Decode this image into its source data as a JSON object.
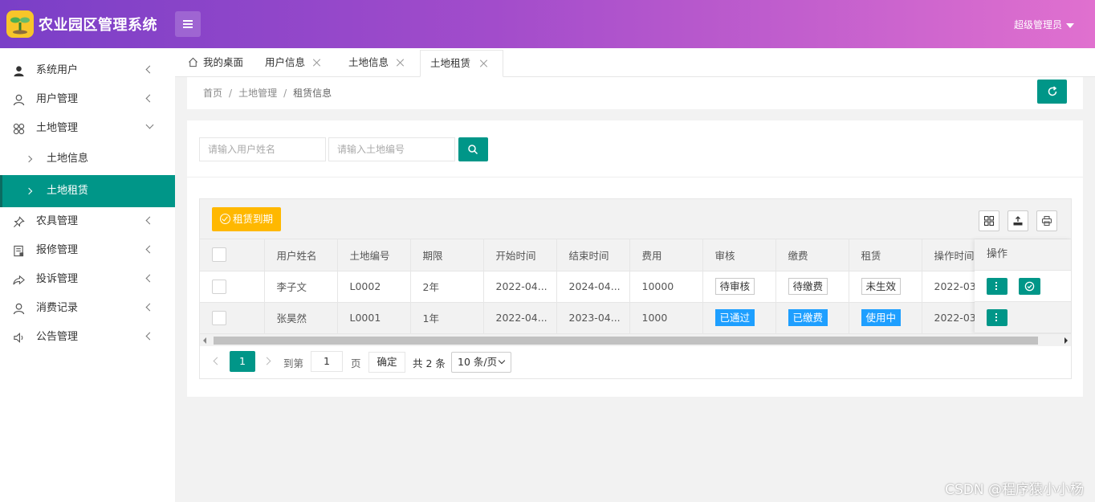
{
  "header": {
    "app_title": "农业园区管理系统",
    "user_label": "超级管理员"
  },
  "sidebar": {
    "items": [
      {
        "label": "系统用户",
        "icon": "person-filled-icon"
      },
      {
        "label": "用户管理",
        "icon": "person-outline-icon"
      },
      {
        "label": "土地管理",
        "icon": "grid-flower-icon",
        "expanded": true,
        "children": [
          {
            "label": "土地信息"
          },
          {
            "label": "土地租赁",
            "active": true
          }
        ]
      },
      {
        "label": "农具管理",
        "icon": "pin-icon"
      },
      {
        "label": "报修管理",
        "icon": "report-icon"
      },
      {
        "label": "投诉管理",
        "icon": "share-arrow-icon"
      },
      {
        "label": "消费记录",
        "icon": "person-outline-icon"
      },
      {
        "label": "公告管理",
        "icon": "speaker-icon"
      }
    ]
  },
  "tabs": [
    {
      "label": "我的桌面",
      "icon": "home-icon"
    },
    {
      "label": "用户信息",
      "closable": true
    },
    {
      "label": "土地信息",
      "closable": true
    },
    {
      "label": "土地租赁",
      "closable": true,
      "active": true
    }
  ],
  "breadcrumb": {
    "home": "首页",
    "section": "土地管理",
    "current": "租赁信息",
    "separator": "/"
  },
  "search": {
    "name_placeholder": "请输入用户姓名",
    "code_placeholder": "请输入土地编号"
  },
  "toolbar": {
    "expire_label": "租赁到期"
  },
  "table": {
    "columns": [
      "用户姓名",
      "土地编号",
      "期限",
      "开始时间",
      "结束时间",
      "费用",
      "审核",
      "缴费",
      "租赁",
      "操作时间"
    ],
    "op_column": "操作",
    "rows": [
      {
        "name": "李子文",
        "code": "L0002",
        "term": "2年",
        "start": "2022-04...",
        "end": "2024-04...",
        "fee": "10000",
        "audit": "待审核",
        "pay": "待缴费",
        "lease": "未生效",
        "optime": "2022-03..."
      },
      {
        "name": "张昊然",
        "code": "L0001",
        "term": "1年",
        "start": "2022-04...",
        "end": "2023-04...",
        "fee": "1000",
        "audit": "已通过",
        "pay": "已缴费",
        "lease": "使用中",
        "optime": "2022-03..."
      }
    ]
  },
  "pager": {
    "current": "1",
    "goto_label": "到第",
    "page_input": "1",
    "page_unit": "页",
    "confirm": "确定",
    "total": "共 2 条",
    "page_size": "10 条/页"
  },
  "watermark": "CSDN @程序猿小小杨",
  "colors": {
    "accent": "#009688",
    "warning": "#ffb800",
    "info": "#1e9fff",
    "header_start": "#7a3fc7",
    "header_end": "#e070cf"
  }
}
